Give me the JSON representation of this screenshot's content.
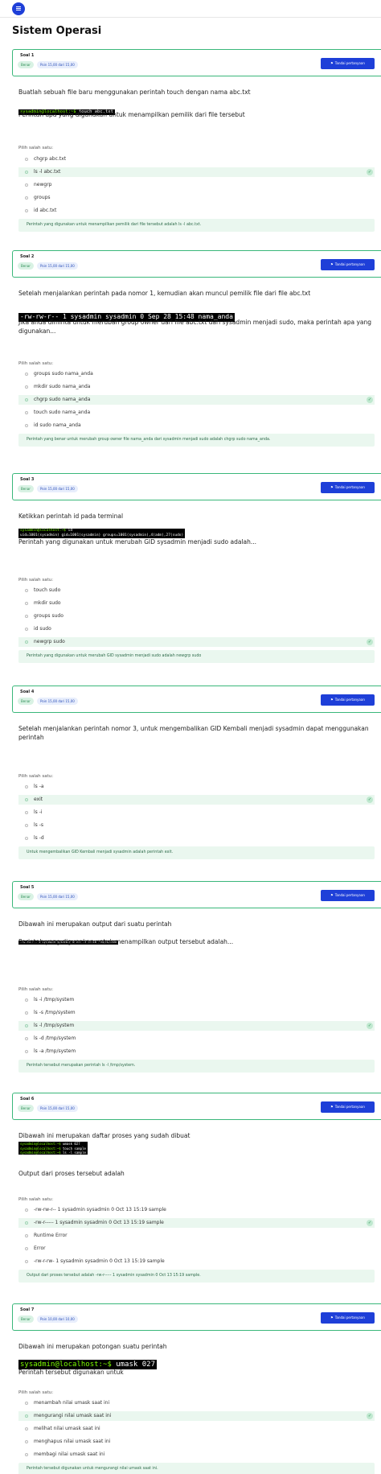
{
  "header": {
    "title": "Sistem Operasi"
  },
  "common": {
    "status": "Benar",
    "flag_label": "Tandai pertanyaan",
    "choose_label": "Pilih salah satu:",
    "check": "✓"
  },
  "questions": [
    {
      "number": "Soal 1",
      "points": "Poin 15,00 dari 15,00",
      "text_before": "Buatlah sebuah file baru menggunakan perintah touch dengan nama abc.txt",
      "terminal": [
        {
          "prompt": "sysadmin@localhost:~$",
          "cmd": " touch abc.txt"
        }
      ],
      "text_after": "Perintah apa yang digunakan untuk menampilkan pemilik dari file tersebut",
      "options": [
        "chgrp abc.txt",
        "ls -l abc.txt",
        "newgrp",
        "groups",
        "id abc.txt"
      ],
      "correct": 1,
      "explanation": "Perintah yang digunakan untuk menampilkan pemilik dari file tersebut adalah ls -l abc.txt."
    },
    {
      "number": "Soal 2",
      "points": "Poin 15,00 dari 15,00",
      "text_before": "Setelah menjalankan perintah pada nomor 1, kemudian akan muncul pemilik file dari file abc.txt",
      "terminal": [
        {
          "prompt": "",
          "cmd": "-rw-rw-r-- 1 sysadmin sysadmin 0 Sep 28 15:48 nama_anda"
        }
      ],
      "text_after": "Jika anda diminta untuk merubah group owner dari file abc.txt dari sysadmin menjadi sudo, maka perintah apa yang digunakan...",
      "options": [
        "groups sudo nama_anda",
        "mkdir sudo nama_anda",
        "chgrp sudo nama_anda",
        "touch sudo nama_anda",
        "id sudo nama_anda"
      ],
      "correct": 2,
      "explanation": "Perintah yang benar untuk merubah group owner file nama_anda dari sysadmin menjadi sudo adalah chgrp sudo nama_anda."
    },
    {
      "number": "Soal 3",
      "points": "Poin 15,00 dari 15,00",
      "text_before": "Ketikkan perintah id pada terminal",
      "terminal": [
        {
          "prompt": "sysadmin@localhost:~$",
          "cmd": " id"
        },
        {
          "prompt": "",
          "cmd": "uid=1001(sysadmin) gid=1001(sysadmin) groups=1001(sysadmin),4(adm),27(sudo)"
        }
      ],
      "text_after": "Perintah yang digunakan untuk merubah GID sysadmin menjadi sudo adalah...",
      "options": [
        "touch sudo",
        "mkdir sudo",
        "groups sudo",
        "id sudo",
        "newgrp sudo"
      ],
      "correct": 4,
      "explanation": "Perintah yang digunakan untuk merubah GID sysadmin menjadi sudo adalah newgrp sudo"
    },
    {
      "number": "Soal 4",
      "points": "Poin 15,00 dari 15,00",
      "text_before": "Setelah menjalankan perintah nomor 3, untuk mengembalikan GID Kembali menjadi sysadmin dapat menggunakan perintah",
      "terminal": [],
      "text_after": "",
      "options": [
        "ls -a",
        "exit",
        "ls -i",
        "ls -s",
        "ls -d"
      ],
      "correct": 1,
      "explanation": "Untuk mengembalikan GID Kembali menjadi sysadmin adalah perintah exit."
    },
    {
      "number": "Soal 5",
      "points": "Poin 15,00 dari 15,00",
      "text_before": "Dibawah ini merupakan output dari suatu perintah",
      "terminal": [
        {
          "prompt": "",
          "cmd": "-rw-rw-r-- 1 sysadmin sysadmin 0 Oct 13 15:16 /tmp/system"
        }
      ],
      "text_after": "Perintah yang digunakan untuk menampilkan output tersebut adalah...",
      "options": [
        "ls -i /tmp/system",
        "ls -s /tmp/system",
        "ls -l /tmp/system",
        "ls -d /tmp/system",
        "ls -a /tmp/system"
      ],
      "correct": 2,
      "explanation": "Perintah tersebut merupakan perintah ls -l /tmp/system."
    },
    {
      "number": "Soal 6",
      "points": "Poin 15,00 dari 15,00",
      "text_before": "Dibawah ini merupakan daftar proses yang sudah dibuat",
      "terminal": [
        {
          "prompt": "sysadmin@localhost:~$",
          "cmd": " umask 027"
        },
        {
          "prompt": "sysadmin@localhost:~$",
          "cmd": " touch sample"
        },
        {
          "prompt": "sysadmin@localhost:~$",
          "cmd": " ls -l sample"
        }
      ],
      "text_after": "Output dari proses tersebut adalah",
      "options": [
        "-rw-rw-r-- 1 sysadmin sysadmin 0 Oct 13 15:19 sample",
        "-rw-r----- 1 sysadmin sysadmin 0 Oct 13 15:19 sample",
        "Runtime Error",
        "Error",
        "-rw-r-rw- 1 sysadmin sysadmin 0 Oct 13 15:19 sample"
      ],
      "correct": 1,
      "explanation": "Output dari proses tersebut adalah -rw-r----- 1 sysadmin sysadmin 0 Oct 13 15:19 sample."
    },
    {
      "number": "Soal 7",
      "points": "Poin 10,00 dari 10,00",
      "text_before": "Dibawah ini merupakan potongan suatu perintah",
      "terminal": [
        {
          "prompt": "sysadmin@localhost:~$",
          "cmd": " umask 027"
        }
      ],
      "text_after": "Perintah tersebut digunakan untuk",
      "options": [
        "menambah nilai umask saat ini",
        "mengurangi nilai umask saat ini",
        "melihat nilai umask saat ini",
        "menghapus nilai umask saat ini",
        "membagi nilai umask saat ini"
      ],
      "correct": 1,
      "explanation": "Perintah tersebut digunakan untuk mengurangi nilai umask saat ini."
    }
  ]
}
